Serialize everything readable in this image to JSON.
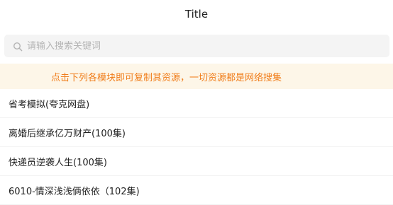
{
  "header": {
    "title": "Title"
  },
  "search": {
    "placeholder": "请输入搜索关键词",
    "value": "",
    "icon": "search-icon"
  },
  "notice": {
    "text": "点击下列各模块即可复制其资源，一切资源都是网络搜集"
  },
  "resources": [
    {
      "label": "省考模拟(夸克网盘)"
    },
    {
      "label": "离婚后继承亿万财产(100集)"
    },
    {
      "label": "快递员逆袭人生(100集)"
    },
    {
      "label": "6010-情深浅浅俩依依（102集)"
    }
  ],
  "colors": {
    "notice_bg": "#fdf6e8",
    "notice_text": "#f07d1a",
    "search_bg": "#f4f4f4",
    "placeholder": "#b4b4b4"
  }
}
